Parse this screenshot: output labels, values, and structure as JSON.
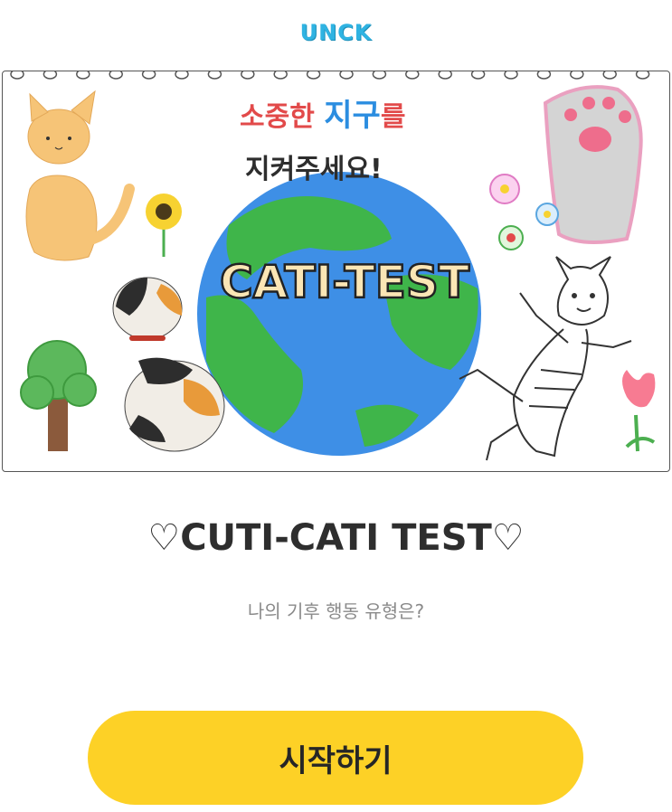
{
  "header": {
    "logo": "UNCK"
  },
  "banner": {
    "headline_part1": "소중한 ",
    "headline_part2": "지구",
    "headline_part3": "를",
    "headline_line2": "지켜주세요!",
    "center_text": "CATI-TEST"
  },
  "main": {
    "title": "♡CUTI-CATI TEST♡",
    "subtitle": "나의 기후 행동 유형은?"
  },
  "actions": {
    "start_label": "시작하기"
  },
  "colors": {
    "logo": "#2fb3e2",
    "button": "#fdd126",
    "earth_ocean": "#3e8fe6",
    "earth_land": "#3fb54a"
  }
}
